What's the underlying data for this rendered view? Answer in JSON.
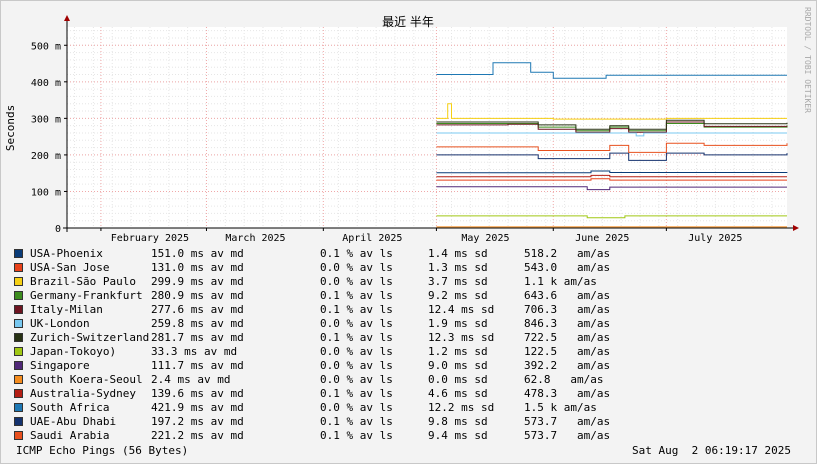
{
  "chart_data": {
    "type": "line",
    "title": "最近 半年",
    "ylabel": "Seconds",
    "watermark": "RRDTOOL / TOBI OETIKER",
    "y_ticks": [
      "0",
      "100 m",
      "200 m",
      "300 m",
      "400 m",
      "500 m"
    ],
    "y_tick_values": [
      0,
      0.1,
      0.2,
      0.3,
      0.4,
      0.5
    ],
    "ylim": [
      0,
      0.55
    ],
    "x_ticks": [
      "February 2025",
      "March 2025",
      "April 2025",
      "May 2025",
      "June 2025",
      "July 2025"
    ],
    "x_tick_dates": [
      "2025-02-01",
      "2025-03-01",
      "2025-04-01",
      "2025-05-01",
      "2025-06-01",
      "2025-07-01"
    ],
    "xlim": [
      "2025-01-23",
      "2025-08-02"
    ],
    "grid": true,
    "series": [
      {
        "name": "USA-Phoenix",
        "color": "#0a3c78",
        "points": [
          [
            "2025-05-01",
            0.151
          ],
          [
            "2025-06-10",
            0.151
          ],
          [
            "2025-06-11",
            0.156
          ],
          [
            "2025-06-16",
            0.152
          ],
          [
            "2025-08-02",
            0.151
          ]
        ]
      },
      {
        "name": "USA-San Jose",
        "color": "#e8421a",
        "points": [
          [
            "2025-05-01",
            0.131
          ],
          [
            "2025-06-10",
            0.131
          ],
          [
            "2025-06-11",
            0.135
          ],
          [
            "2025-06-16",
            0.131
          ],
          [
            "2025-08-02",
            0.131
          ]
        ]
      },
      {
        "name": "Brazil-São Paulo",
        "color": "#f5d014",
        "points": [
          [
            "2025-05-01",
            0.3
          ],
          [
            "2025-05-04",
            0.34
          ],
          [
            "2025-05-05",
            0.3
          ],
          [
            "2025-06-01",
            0.298
          ],
          [
            "2025-07-01",
            0.3
          ],
          [
            "2025-08-02",
            0.3
          ]
        ]
      },
      {
        "name": "Germany-Frankfurt",
        "color": "#3c8c1e",
        "points": [
          [
            "2025-05-01",
            0.286
          ],
          [
            "2025-05-20",
            0.286
          ],
          [
            "2025-05-28",
            0.276
          ],
          [
            "2025-06-07",
            0.266
          ],
          [
            "2025-06-16",
            0.276
          ],
          [
            "2025-06-21",
            0.266
          ],
          [
            "2025-07-01",
            0.286
          ],
          [
            "2025-07-11",
            0.276
          ],
          [
            "2025-08-02",
            0.281
          ]
        ]
      },
      {
        "name": "Italy-Milan",
        "color": "#6e1420",
        "points": [
          [
            "2025-05-01",
            0.282
          ],
          [
            "2025-05-20",
            0.284
          ],
          [
            "2025-05-28",
            0.27
          ],
          [
            "2025-06-07",
            0.262
          ],
          [
            "2025-06-16",
            0.272
          ],
          [
            "2025-06-21",
            0.262
          ],
          [
            "2025-07-01",
            0.29
          ],
          [
            "2025-07-11",
            0.278
          ],
          [
            "2025-08-02",
            0.277
          ]
        ]
      },
      {
        "name": "UK-London",
        "color": "#78c8f0",
        "points": [
          [
            "2025-05-01",
            0.26
          ],
          [
            "2025-06-15",
            0.26
          ],
          [
            "2025-06-20",
            0.26
          ],
          [
            "2025-06-23",
            0.252
          ],
          [
            "2025-06-25",
            0.26
          ],
          [
            "2025-08-02",
            0.26
          ]
        ]
      },
      {
        "name": "Zurich-Switzerland",
        "color": "#283214",
        "points": [
          [
            "2025-05-01",
            0.29
          ],
          [
            "2025-05-20",
            0.29
          ],
          [
            "2025-05-28",
            0.282
          ],
          [
            "2025-06-07",
            0.27
          ],
          [
            "2025-06-16",
            0.28
          ],
          [
            "2025-06-21",
            0.27
          ],
          [
            "2025-07-01",
            0.295
          ],
          [
            "2025-07-11",
            0.285
          ],
          [
            "2025-08-02",
            0.288
          ]
        ]
      },
      {
        "name": "Japan-Tokoyo)",
        "color": "#a0c814",
        "points": [
          [
            "2025-05-01",
            0.033
          ],
          [
            "2025-06-01",
            0.033
          ],
          [
            "2025-06-10",
            0.028
          ],
          [
            "2025-06-20",
            0.033
          ],
          [
            "2025-08-02",
            0.033
          ]
        ]
      },
      {
        "name": "Singapore",
        "color": "#502878",
        "points": [
          [
            "2025-05-01",
            0.113
          ],
          [
            "2025-06-01",
            0.113
          ],
          [
            "2025-06-10",
            0.105
          ],
          [
            "2025-06-16",
            0.112
          ],
          [
            "2025-07-01",
            0.112
          ],
          [
            "2025-08-02",
            0.112
          ]
        ]
      },
      {
        "name": "South Koera-Seoul",
        "color": "#f58c1e",
        "points": [
          [
            "2025-05-01",
            0.003
          ],
          [
            "2025-08-02",
            0.003
          ]
        ]
      },
      {
        "name": "Australia-Sydney",
        "color": "#b41e14",
        "points": [
          [
            "2025-05-01",
            0.14
          ],
          [
            "2025-06-10",
            0.14
          ],
          [
            "2025-06-11",
            0.144
          ],
          [
            "2025-06-16",
            0.14
          ],
          [
            "2025-08-02",
            0.14
          ]
        ]
      },
      {
        "name": "South Africa",
        "color": "#1e78b4",
        "points": [
          [
            "2025-05-01",
            0.42
          ],
          [
            "2025-05-15",
            0.42
          ],
          [
            "2025-05-16",
            0.452
          ],
          [
            "2025-05-25",
            0.452
          ],
          [
            "2025-05-26",
            0.426
          ],
          [
            "2025-06-01",
            0.41
          ],
          [
            "2025-06-15",
            0.418
          ],
          [
            "2025-07-01",
            0.418
          ],
          [
            "2025-08-02",
            0.418
          ]
        ]
      },
      {
        "name": "UAE-Abu Dhabi",
        "color": "#14326e",
        "points": [
          [
            "2025-05-01",
            0.2
          ],
          [
            "2025-05-20",
            0.2
          ],
          [
            "2025-05-28",
            0.19
          ],
          [
            "2025-06-07",
            0.19
          ],
          [
            "2025-06-16",
            0.205
          ],
          [
            "2025-06-21",
            0.185
          ],
          [
            "2025-07-01",
            0.205
          ],
          [
            "2025-07-11",
            0.2
          ],
          [
            "2025-08-02",
            0.205
          ]
        ]
      },
      {
        "name": "Saudi Arabia",
        "color": "#e8501e",
        "points": [
          [
            "2025-05-01",
            0.222
          ],
          [
            "2025-05-20",
            0.222
          ],
          [
            "2025-05-28",
            0.212
          ],
          [
            "2025-06-07",
            0.212
          ],
          [
            "2025-06-16",
            0.226
          ],
          [
            "2025-06-21",
            0.207
          ],
          [
            "2025-07-01",
            0.232
          ],
          [
            "2025-07-11",
            0.226
          ],
          [
            "2025-08-02",
            0.232
          ]
        ]
      }
    ]
  },
  "legend": [
    {
      "name": "USA-Phoenix",
      "avg": "151.0 ms av md",
      "loss": "0.1 % av ls",
      "sd": "1.4 ms sd",
      "am": "518.2   am/as"
    },
    {
      "name": "USA-San Jose",
      "avg": "131.0 ms av md",
      "loss": "0.0 % av ls",
      "sd": "1.3 ms sd",
      "am": "543.0   am/as"
    },
    {
      "name": "Brazil-São Paulo",
      "avg": "299.9 ms av md",
      "loss": "0.0 % av ls",
      "sd": "3.7 ms sd",
      "am": "1.1 k am/as"
    },
    {
      "name": "Germany-Frankfurt",
      "avg": "280.9 ms av md",
      "loss": "0.1 % av ls",
      "sd": "9.2 ms sd",
      "am": "643.6   am/as"
    },
    {
      "name": "Italy-Milan",
      "avg": "277.6 ms av md",
      "loss": "0.1 % av ls",
      "sd": "12.4 ms sd",
      "am": "706.3   am/as"
    },
    {
      "name": "UK-London",
      "avg": "259.8 ms av md",
      "loss": "0.0 % av ls",
      "sd": "1.9 ms sd",
      "am": "846.3   am/as"
    },
    {
      "name": "Zurich-Switzerland",
      "avg": "281.7 ms av md",
      "loss": "0.1 % av ls",
      "sd": "12.3 ms sd",
      "am": "722.5   am/as"
    },
    {
      "name": "Japan-Tokoyo)",
      "avg": "33.3 ms av md",
      "loss": "0.0 % av ls",
      "sd": "1.2 ms sd",
      "am": "122.5   am/as"
    },
    {
      "name": "Singapore",
      "avg": "111.7 ms av md",
      "loss": "0.0 % av ls",
      "sd": "9.0 ms sd",
      "am": "392.2   am/as"
    },
    {
      "name": "South Koera-Seoul",
      "avg": "2.4 ms av md",
      "loss": "0.0 % av ls",
      "sd": "0.0 ms sd",
      "am": "62.8   am/as"
    },
    {
      "name": "Australia-Sydney",
      "avg": "139.6 ms av md",
      "loss": "0.1 % av ls",
      "sd": "4.6 ms sd",
      "am": "478.3   am/as"
    },
    {
      "name": "South Africa",
      "avg": "421.9 ms av md",
      "loss": "0.0 % av ls",
      "sd": "12.2 ms sd",
      "am": "1.5 k am/as"
    },
    {
      "name": "UAE-Abu Dhabi",
      "avg": "197.2 ms av md",
      "loss": "0.1 % av ls",
      "sd": "9.8 ms sd",
      "am": "573.7   am/as"
    },
    {
      "name": "Saudi Arabia",
      "avg": "221.2 ms av md",
      "loss": "0.1 % av ls",
      "sd": "9.4 ms sd",
      "am": "573.7   am/as"
    }
  ],
  "footer": {
    "probe": "ICMP Echo Pings (56 Bytes)",
    "timestamp": "Sat Aug  2 06:19:17 2025"
  }
}
